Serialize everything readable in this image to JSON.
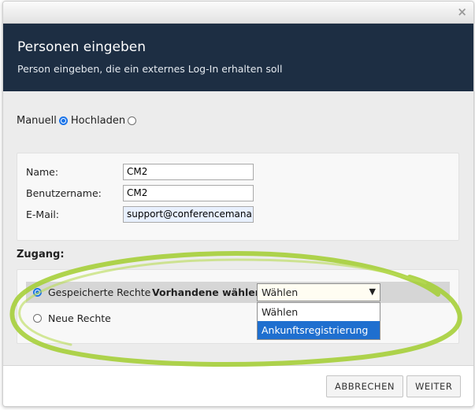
{
  "dialog": {
    "close_glyph": "×",
    "title": "Personen eingeben",
    "subtitle": "Person eingeben, die ein externes Log-In erhalten soll"
  },
  "mode": {
    "manual_label": "Manuell",
    "upload_label": "Hochladen",
    "selected": "Manuell"
  },
  "form": {
    "name_label": "Name:",
    "name_value": "CM2",
    "username_label": "Benutzername:",
    "username_value": "CM2",
    "email_label": "E-Mail:",
    "email_value": "support@conferencemana"
  },
  "access": {
    "label": "Zugang:",
    "saved_rights_label": "Gespeicherte Rechte",
    "choose_existing_label": "Vorhandene wählen:",
    "select_value": "Wählen",
    "options": [
      "Wählen",
      "Ankunftsregistrierung"
    ],
    "highlighted_option": "Ankunftsregistrierung",
    "new_rights_label": "Neue Rechte"
  },
  "footer": {
    "cancel_label": "ABBRECHEN",
    "next_label": "WEITER"
  },
  "colors": {
    "header_bg": "#1d2e43",
    "accent": "#1a73e8",
    "highlight_ring": "#a6cf3a",
    "selected_option_bg": "#1f6fcf"
  }
}
